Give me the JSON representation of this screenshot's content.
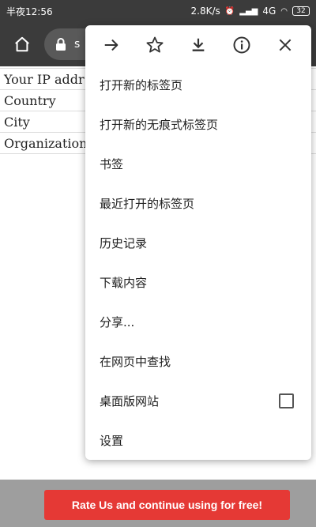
{
  "status_bar": {
    "time": "半夜12:56",
    "net_speed": "2.8K/s",
    "network": "4G",
    "battery": "32"
  },
  "browser": {
    "url_partial": "s"
  },
  "page": {
    "rows": [
      "Your IP addr",
      "Country",
      "City",
      "Organization"
    ]
  },
  "menu": {
    "icon_row": [
      "forward-icon",
      "star-icon",
      "download-icon",
      "info-icon",
      "close-icon"
    ],
    "items": [
      "打开新的标签页",
      "打开新的无痕式标签页",
      "书签",
      "最近打开的标签页",
      "历史记录",
      "下载内容",
      "分享...",
      "在网页中查找",
      "桌面版网站",
      "设置"
    ],
    "desktop_site_checked": false
  },
  "banner": {
    "label": "Rate Us and continue using for free!",
    "color": "#e53935"
  }
}
